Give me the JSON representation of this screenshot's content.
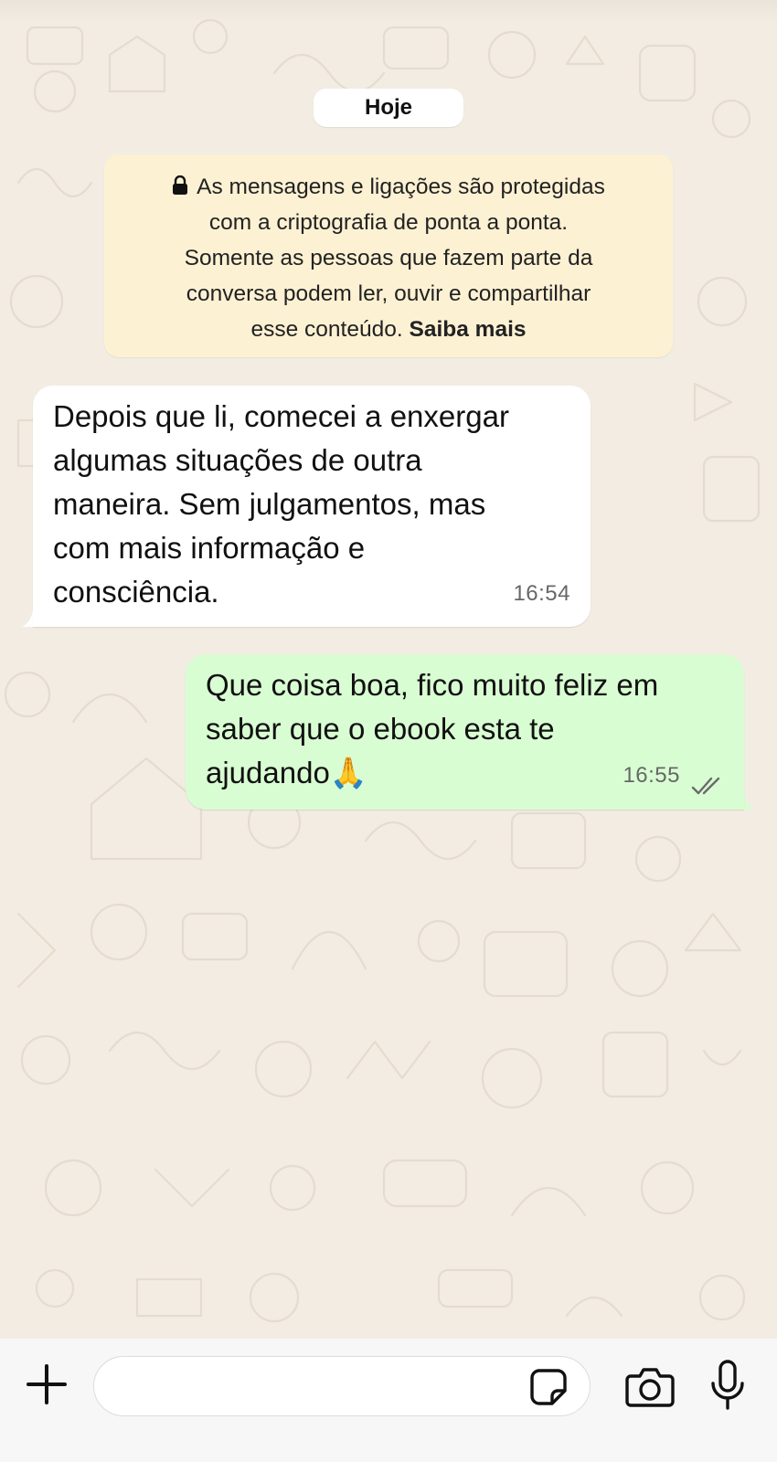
{
  "chat": {
    "date_label": "Hoje",
    "encryption_notice": {
      "text": "As mensagens e ligações são protegidas\ncom a criptografia de ponta a ponta.\nSomente as pessoas que fazem parte da\nconversa podem ler, ouvir e compartilhar\nesse conteúdo. ",
      "learn_more": "Saiba mais"
    },
    "messages": [
      {
        "direction": "incoming",
        "text": "Depois que li, comecei a enxergar\nalgumas situações de outra\nmaneira. Sem julgamentos, mas\ncom mais informação e\nconsciência.",
        "time": "16:54"
      },
      {
        "direction": "outgoing",
        "text": "Que coisa boa, fico muito feliz em\nsaber que o ebook esta te\najudando🙏",
        "time": "16:55",
        "status_icon": "double-check-read-icon"
      }
    ]
  },
  "composer": {
    "value": "",
    "icons": [
      "plus-icon",
      "sticker-icon",
      "camera-icon",
      "microphone-icon"
    ]
  },
  "colors": {
    "background": "#f2ece2",
    "incoming_bubble": "#ffffff",
    "outgoing_bubble": "#d9fdd3",
    "encryption_notice": "#fdf1d3"
  }
}
